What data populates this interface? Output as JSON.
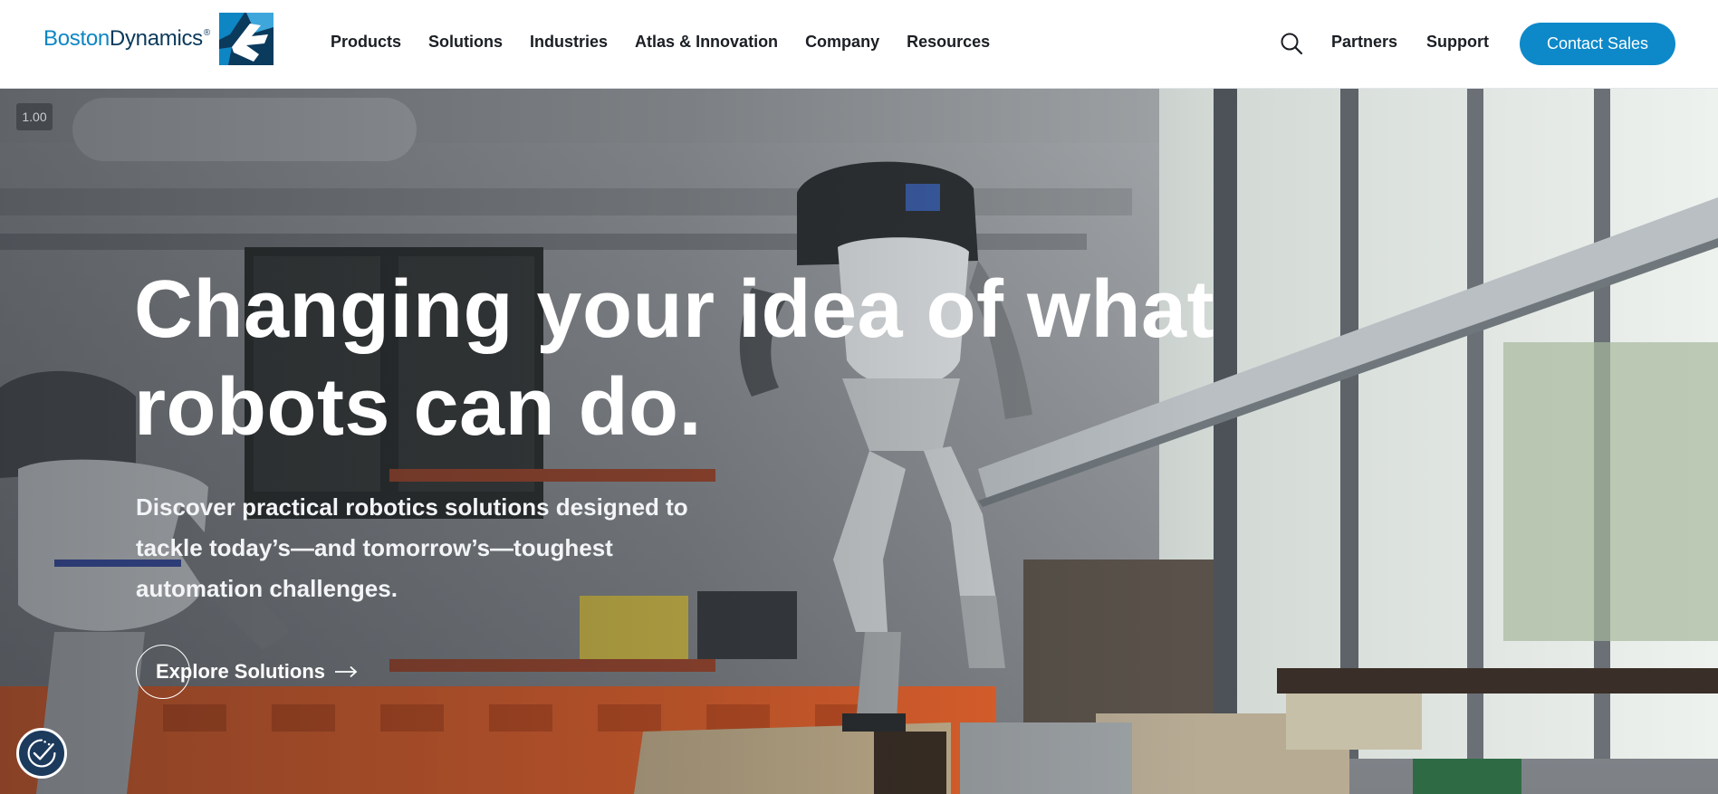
{
  "brand": {
    "name_part1": "Boston",
    "name_part2": "Dynamics",
    "registered": "®",
    "logo_icon": "boston-dynamics-logo-icon"
  },
  "nav": {
    "items": [
      {
        "label": "Products"
      },
      {
        "label": "Solutions"
      },
      {
        "label": "Industries"
      },
      {
        "label": "Atlas & Innovation"
      },
      {
        "label": "Company"
      },
      {
        "label": "Resources"
      }
    ],
    "search_icon": "search-icon",
    "partners": "Partners",
    "support": "Support",
    "contact_sales": "Contact Sales"
  },
  "hero": {
    "speed_badge": "1.00",
    "headline_line1": "Changing your idea of what",
    "headline_line2": "robots can do.",
    "subtext_line1": "Discover practical robotics solutions designed to",
    "subtext_line2": "tackle today’s—and tomorrow’s—toughest",
    "subtext_line3": "automation challenges.",
    "cta_label": "Explore Solutions",
    "cta_icon": "arrow-right-icon",
    "accessibility_icon": "accessibility-check-icon"
  },
  "colors": {
    "brand_blue": "#0d89c9",
    "brand_navy": "#0a3a5c",
    "text_dark": "#1b1f24",
    "orange_crates": "#e8632c"
  }
}
